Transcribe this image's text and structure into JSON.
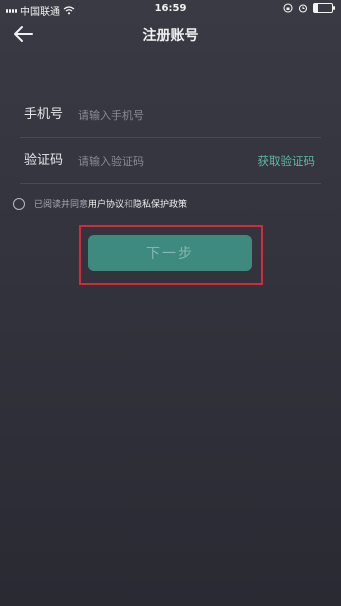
{
  "status": {
    "carrier": "中国联通",
    "time": "16:59",
    "battery_level": 0.2
  },
  "nav": {
    "title": "注册账号",
    "back_icon": "arrow-left-icon"
  },
  "form": {
    "phone": {
      "label": "手机号",
      "placeholder": "请输入手机号",
      "value": ""
    },
    "code": {
      "label": "验证码",
      "placeholder": "请输入验证码",
      "value": "",
      "get_code_label": "获取验证码"
    }
  },
  "agreement": {
    "prefix": "已阅读并同意",
    "user_agreement": "用户协议",
    "and": "和",
    "privacy_policy": "隐私保护政策",
    "checked": false
  },
  "next_button": {
    "label": "下一步",
    "enabled": false
  },
  "colors": {
    "accent": "#5fb8a8",
    "button_bg": "#3f8a7f",
    "highlight": "#d42a3a",
    "bg": "#33333d"
  }
}
